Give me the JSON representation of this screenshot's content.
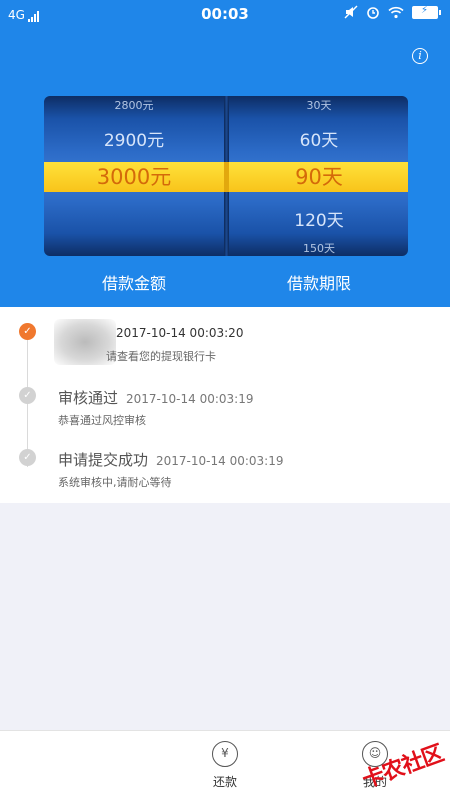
{
  "status_bar": {
    "network": "4G",
    "time": "00:03"
  },
  "picker": {
    "amounts": {
      "far_above": "2800元",
      "above": "2900元",
      "selected": "3000元",
      "below": "",
      "far_below": ""
    },
    "terms": {
      "far_above": "30天",
      "above": "60天",
      "selected": "90天",
      "below": "120天",
      "far_below": "150天"
    },
    "amount_label": "借款金额",
    "term_label": "借款期限"
  },
  "timeline": [
    {
      "title": "",
      "time": "2017-10-14 00:03:20",
      "desc": "请查看您的提现银行卡",
      "active": true
    },
    {
      "title": "审核通过",
      "time": "2017-10-14 00:03:19",
      "desc": "恭喜通过风控审核",
      "active": false
    },
    {
      "title": "申请提交成功",
      "time": "2017-10-14 00:03:19",
      "desc": "系统审核中,请耐心等待",
      "active": false
    }
  ],
  "nav": {
    "repay_label": "还款",
    "mine_label": "我的"
  },
  "watermark": "卡农社区",
  "colors": {
    "header_blue": "#1f86e9",
    "highlight_yellow": "#ffd52a",
    "active_orange": "#f0782e"
  }
}
